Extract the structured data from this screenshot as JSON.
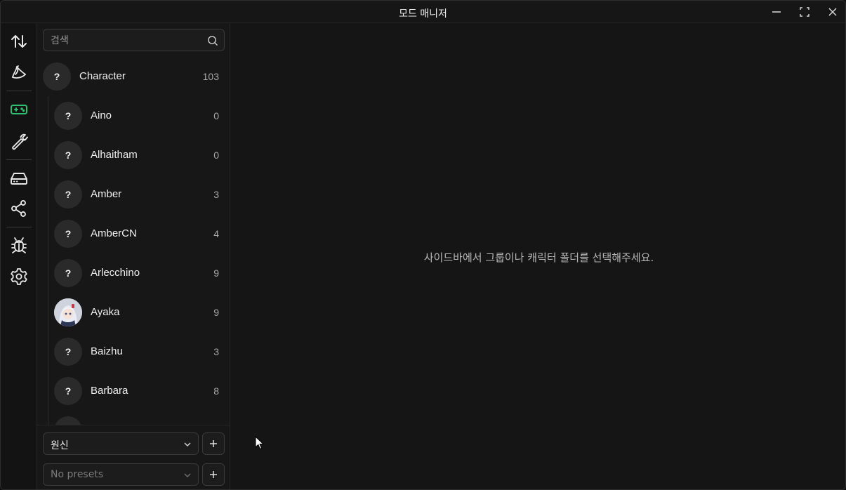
{
  "window": {
    "title": "모드 매니저",
    "controls": [
      "minimize-icon",
      "maximize-icon",
      "close-icon"
    ]
  },
  "rail": {
    "items": [
      {
        "name": "sort-icon",
        "active": false
      },
      {
        "name": "banana-icon",
        "active": false
      },
      {
        "name": "gamepad-icon",
        "active": true
      },
      {
        "name": "wrench-icon",
        "active": false
      },
      {
        "name": "drive-icon",
        "active": false
      },
      {
        "name": "share-icon",
        "active": false
      },
      {
        "name": "bug-icon",
        "active": false
      },
      {
        "name": "settings-icon",
        "active": false
      }
    ]
  },
  "sidebar": {
    "search": {
      "placeholder": "검색",
      "value": ""
    },
    "group": {
      "name": "Character",
      "count": "103",
      "avatar": "?"
    },
    "items": [
      {
        "name": "Aino",
        "count": "0",
        "avatar": "?"
      },
      {
        "name": "Alhaitham",
        "count": "0",
        "avatar": "?"
      },
      {
        "name": "Amber",
        "count": "3",
        "avatar": "?"
      },
      {
        "name": "AmberCN",
        "count": "4",
        "avatar": "?"
      },
      {
        "name": "Arlecchino",
        "count": "9",
        "avatar": "?"
      },
      {
        "name": "Ayaka",
        "count": "9",
        "avatar": "portrait"
      },
      {
        "name": "Baizhu",
        "count": "3",
        "avatar": "?"
      },
      {
        "name": "Barbara",
        "count": "8",
        "avatar": "?"
      }
    ],
    "game_select": {
      "value": "원신"
    },
    "preset_select": {
      "value": "No presets"
    }
  },
  "main": {
    "empty_message": "사이드바에서 그룹이나 캐릭터 폴더를 선택해주세요."
  },
  "colors": {
    "accent": "#2fbf71",
    "background": "#161616",
    "text": "#e6e6e6"
  }
}
